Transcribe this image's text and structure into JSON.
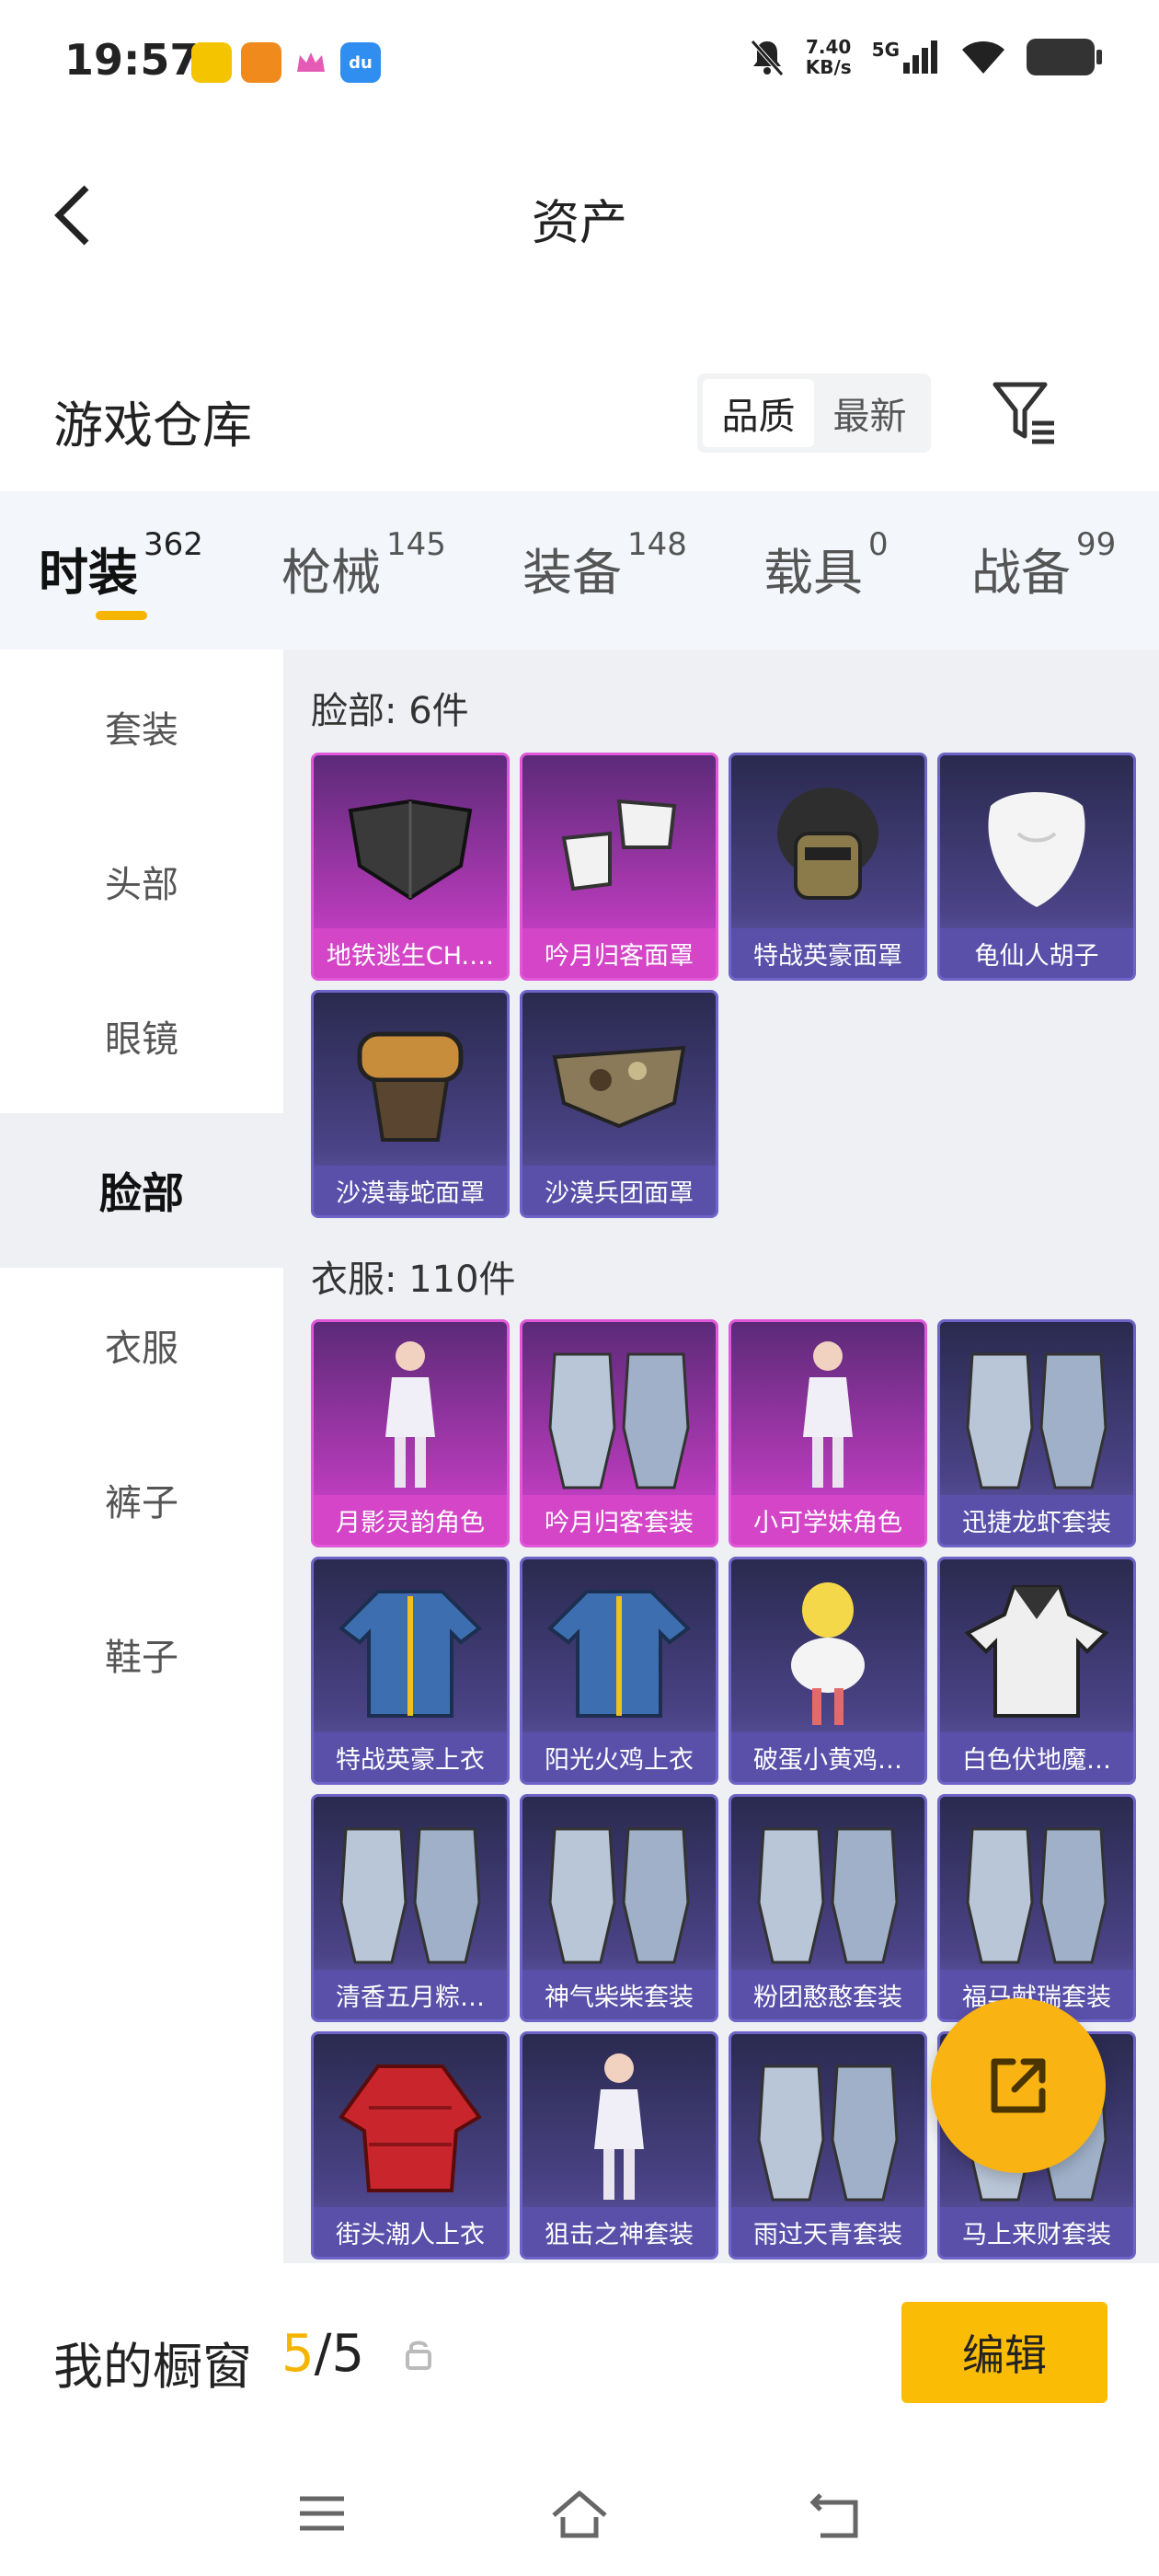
{
  "status_bar": {
    "time": "19:57",
    "speed_value": "7.40",
    "speed_unit": "KB/s",
    "network": "5G",
    "app_icons": [
      "app-icon-1",
      "app-icon-2",
      "crown-icon",
      "du-icon"
    ]
  },
  "header": {
    "title": "资产"
  },
  "warehouse": {
    "title": "游戏仓库",
    "sort_options": [
      "品质",
      "最新"
    ],
    "selected_sort": "品质"
  },
  "tabs": [
    {
      "label": "时装",
      "count": "362"
    },
    {
      "label": "枪械",
      "count": "145"
    },
    {
      "label": "装备",
      "count": "148"
    },
    {
      "label": "载具",
      "count": "0"
    },
    {
      "label": "战备",
      "count": "99"
    }
  ],
  "sidebar": {
    "items": [
      "套装",
      "头部",
      "眼镜",
      "脸部",
      "衣服",
      "裤子",
      "鞋子"
    ],
    "active": "脸部"
  },
  "sections": [
    {
      "title": "脸部: 6件",
      "items": [
        {
          "name": "地铁逃生CH.…",
          "rarity": "pink",
          "icon": "black-mask-icon"
        },
        {
          "name": "吟月归客面罩",
          "rarity": "pink",
          "icon": "white-mask-icon"
        },
        {
          "name": "特战英豪面罩",
          "rarity": "blue",
          "icon": "helmet-mask-icon"
        },
        {
          "name": "龟仙人胡子",
          "rarity": "blue",
          "icon": "beard-icon"
        },
        {
          "name": "沙漠毒蛇面罩",
          "rarity": "blue",
          "icon": "goggle-mask-icon"
        },
        {
          "name": "沙漠兵团面罩",
          "rarity": "blue",
          "icon": "camo-mask-icon"
        }
      ]
    },
    {
      "title": "衣服: 110件",
      "items": [
        {
          "name": "月影灵韵角色",
          "rarity": "pink",
          "icon": "character-icon"
        },
        {
          "name": "吟月归客套装",
          "rarity": "pink",
          "icon": "outfit-icon"
        },
        {
          "name": "小可学妹角色",
          "rarity": "pink",
          "icon": "character-icon"
        },
        {
          "name": "迅捷龙虾套装",
          "rarity": "blue",
          "icon": "outfit-icon"
        },
        {
          "name": "特战英豪上衣",
          "rarity": "blue",
          "icon": "jacket-icon"
        },
        {
          "name": "阳光火鸡上衣",
          "rarity": "blue",
          "icon": "jacket-icon"
        },
        {
          "name": "破蛋小黄鸡…",
          "rarity": "blue",
          "icon": "chick-costume-icon"
        },
        {
          "name": "白色伏地魔…",
          "rarity": "blue",
          "icon": "hoodie-icon"
        },
        {
          "name": "清香五月粽…",
          "rarity": "blue",
          "icon": "outfit-icon"
        },
        {
          "name": "神气柴柴套装",
          "rarity": "blue",
          "icon": "outfit-icon"
        },
        {
          "name": "粉团憨憨套装",
          "rarity": "blue",
          "icon": "outfit-icon"
        },
        {
          "name": "福马献瑞套装",
          "rarity": "blue",
          "icon": "outfit-icon"
        },
        {
          "name": "街头潮人上衣",
          "rarity": "blue",
          "icon": "puffer-jacket-icon"
        },
        {
          "name": "狙击之神套装",
          "rarity": "blue",
          "icon": "character-icon"
        },
        {
          "name": "雨过天青套装",
          "rarity": "blue",
          "icon": "outfit-icon"
        },
        {
          "name": "马上来财套装",
          "rarity": "blue",
          "icon": "outfit-icon"
        }
      ]
    }
  ],
  "showcase": {
    "label": "我的橱窗",
    "current": "5",
    "separator": "/",
    "total": "5",
    "edit_label": "编辑"
  },
  "colors": {
    "accent": "#f5b400",
    "pink_rarity": "#d445c8",
    "blue_rarity": "#5a50aa"
  }
}
